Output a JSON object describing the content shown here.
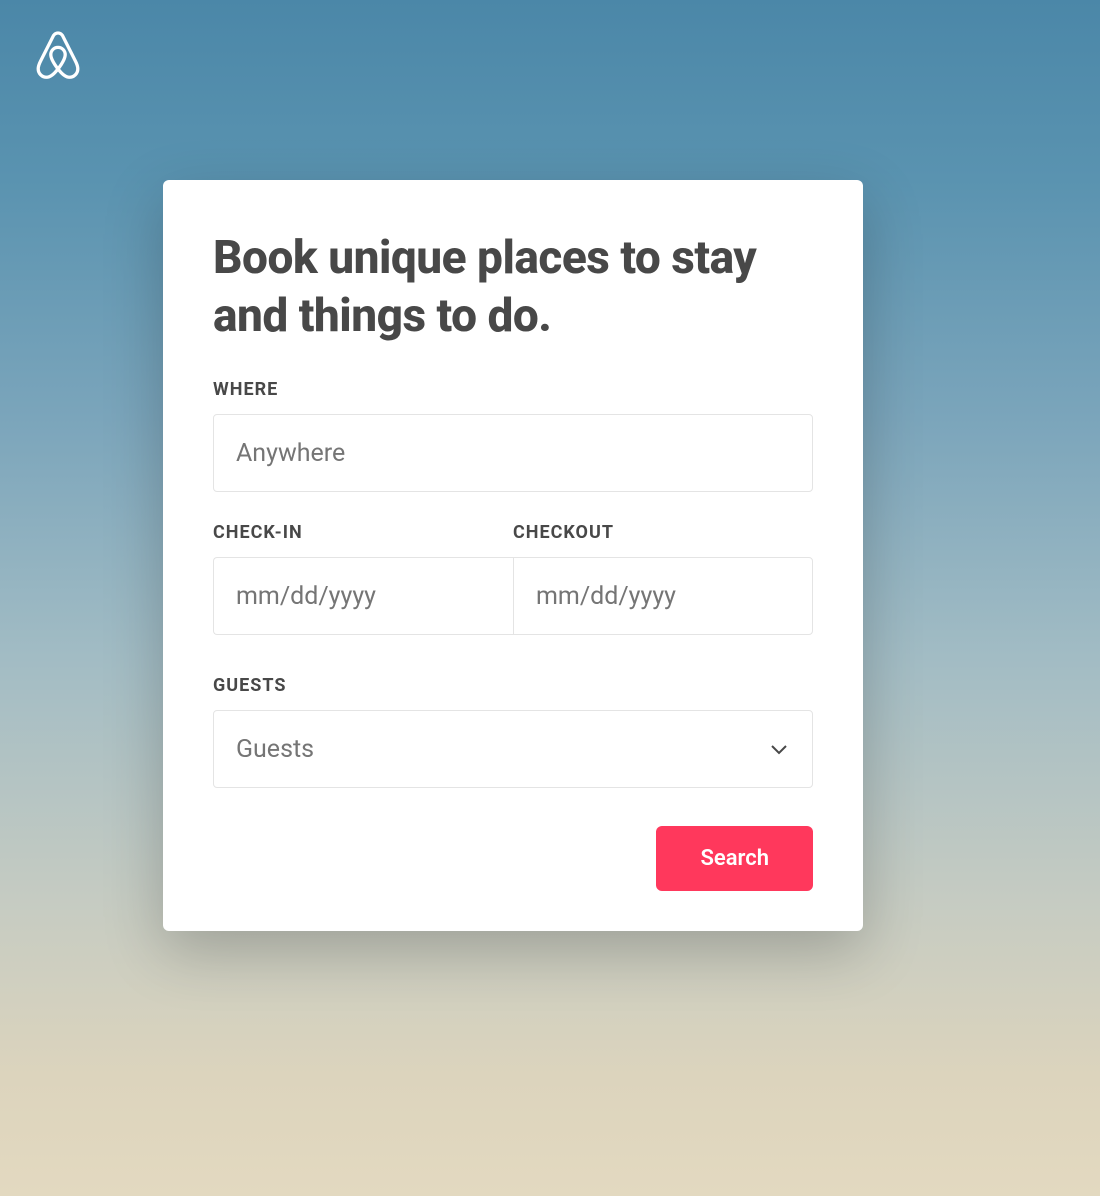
{
  "heading": "Book unique places to stay and things to do.",
  "where": {
    "label": "WHERE",
    "placeholder": "Anywhere",
    "value": ""
  },
  "checkin": {
    "label": "CHECK-IN",
    "placeholder": "mm/dd/yyyy",
    "value": ""
  },
  "checkout": {
    "label": "CHECKOUT",
    "placeholder": "mm/dd/yyyy",
    "value": ""
  },
  "guests": {
    "label": "GUESTS",
    "placeholder": "Guests",
    "value": ""
  },
  "search_button_label": "Search",
  "colors": {
    "accent": "#FF385C",
    "text_primary": "#484848",
    "text_muted": "#757575",
    "border": "#e4e4e4"
  }
}
